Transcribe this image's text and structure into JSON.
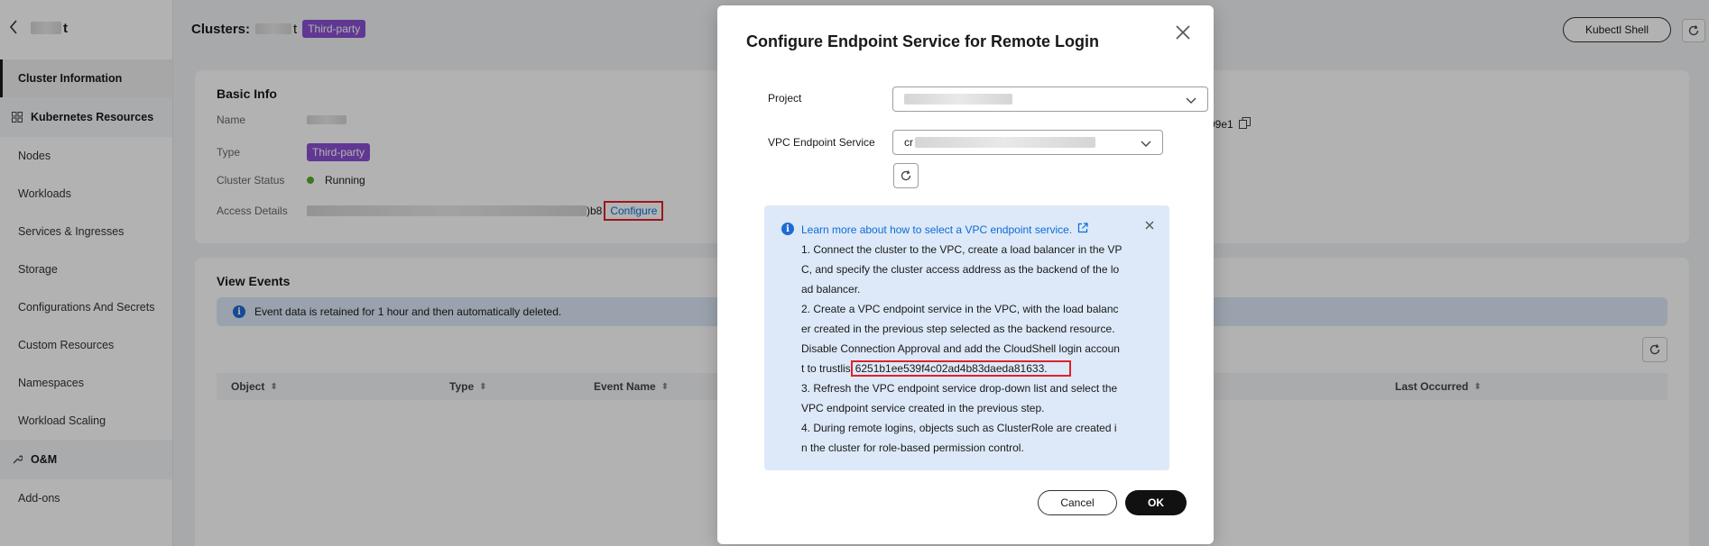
{
  "sidebar": {
    "back_icon": "chevron-left-icon",
    "cluster_name_suffix": "t",
    "items": {
      "cluster_information": "Cluster Information",
      "kubernetes_resources": "Kubernetes Resources",
      "nodes": "Nodes",
      "workloads": "Workloads",
      "services_ingresses": "Services & Ingresses",
      "storage": "Storage",
      "configurations_secrets": "Configurations And Secrets",
      "custom_resources": "Custom Resources",
      "namespaces": "Namespaces",
      "workload_scaling": "Workload Scaling",
      "om": "O&M",
      "add_ons": "Add-ons"
    }
  },
  "header": {
    "title_prefix": "Clusters:",
    "title_suffix": "t",
    "tag": "Third-party",
    "kubectl_shell": "Kubectl Shell"
  },
  "basic_info": {
    "title": "Basic Info",
    "name_label": "Name",
    "type_label": "Type",
    "type_value": "Third-party",
    "status_label": "Cluster Status",
    "status_value": "Running",
    "access_label": "Access Details",
    "access_suffix": ")b8",
    "configure_link": "Configure",
    "right_value_suffix": "09e1"
  },
  "events": {
    "title": "View Events",
    "notice": "Event data is retained for 1 hour and then automatically deleted.",
    "columns": {
      "object": "Object",
      "type": "Type",
      "event_name": "Event Name",
      "last_occurred": "Last Occurred"
    }
  },
  "dialog": {
    "title": "Configure Endpoint Service for Remote Login",
    "project_label": "Project",
    "vpc_label": "VPC Endpoint Service",
    "vpc_value_prefix": "cr",
    "alert": {
      "link": "Learn more about how to select a VPC endpoint service.",
      "lines": [
        "1. Connect the cluster to the VPC, create a load balancer in the VP",
        "C, and specify the cluster access address as the backend of the lo",
        "ad balancer.",
        "2. Create a VPC endpoint service in the VPC, with the load balanc",
        "er created in the previous step selected as the backend resource.",
        "Disable Connection Approval and add the CloudShell login accoun"
      ],
      "trustlist_prefix": "t to trustlis",
      "account_id": "6251b1ee539f4c02ad4b83daeda81633.",
      "lines_after": [
        "3. Refresh the VPC endpoint service drop-down list and select the",
        "VPC endpoint service created in the previous step.",
        "4. During remote logins, objects such as ClusterRole are created i",
        "n the cluster for role-based permission control."
      ]
    },
    "cancel": "Cancel",
    "ok": "OK"
  }
}
